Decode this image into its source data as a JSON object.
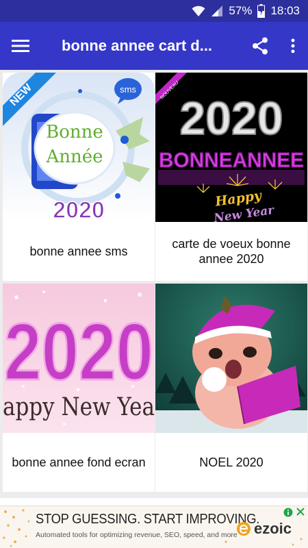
{
  "status_bar": {
    "battery_percent": "57%",
    "time": "18:03"
  },
  "app_bar": {
    "title": "bonne annee cart d...",
    "icons": [
      "menu-icon",
      "share-icon",
      "more-vert-icon"
    ]
  },
  "grid": {
    "items": [
      {
        "label": "bonne annee sms",
        "thumb": {
          "badge": "NEW",
          "sms": "sms",
          "line1": "Bonne",
          "line2": "Année",
          "year": "2020"
        }
      },
      {
        "label": "carte de voeux bonne annee 2020",
        "thumb": {
          "badge": "NOUVEAU",
          "year": "2020",
          "text": "BONNEANNEE",
          "happy": "Happy",
          "new_year": "New Year"
        }
      },
      {
        "label": "bonne annee fond ecran",
        "thumb": {
          "year": "2020",
          "text": "appy New Yea"
        }
      },
      {
        "label": "NOEL 2020",
        "thumb": {}
      }
    ]
  },
  "ad": {
    "headline": "STOP GUESSING. START IMPROVING.",
    "subtext": "Automated tools for optimizing revenue, SEO, speed, and more",
    "brand": "ezoic"
  },
  "colors": {
    "status_bar": "#2d2f9e",
    "app_bar": "#3437c8",
    "grid_background": "#ececec",
    "magenta": "#c026c8"
  }
}
